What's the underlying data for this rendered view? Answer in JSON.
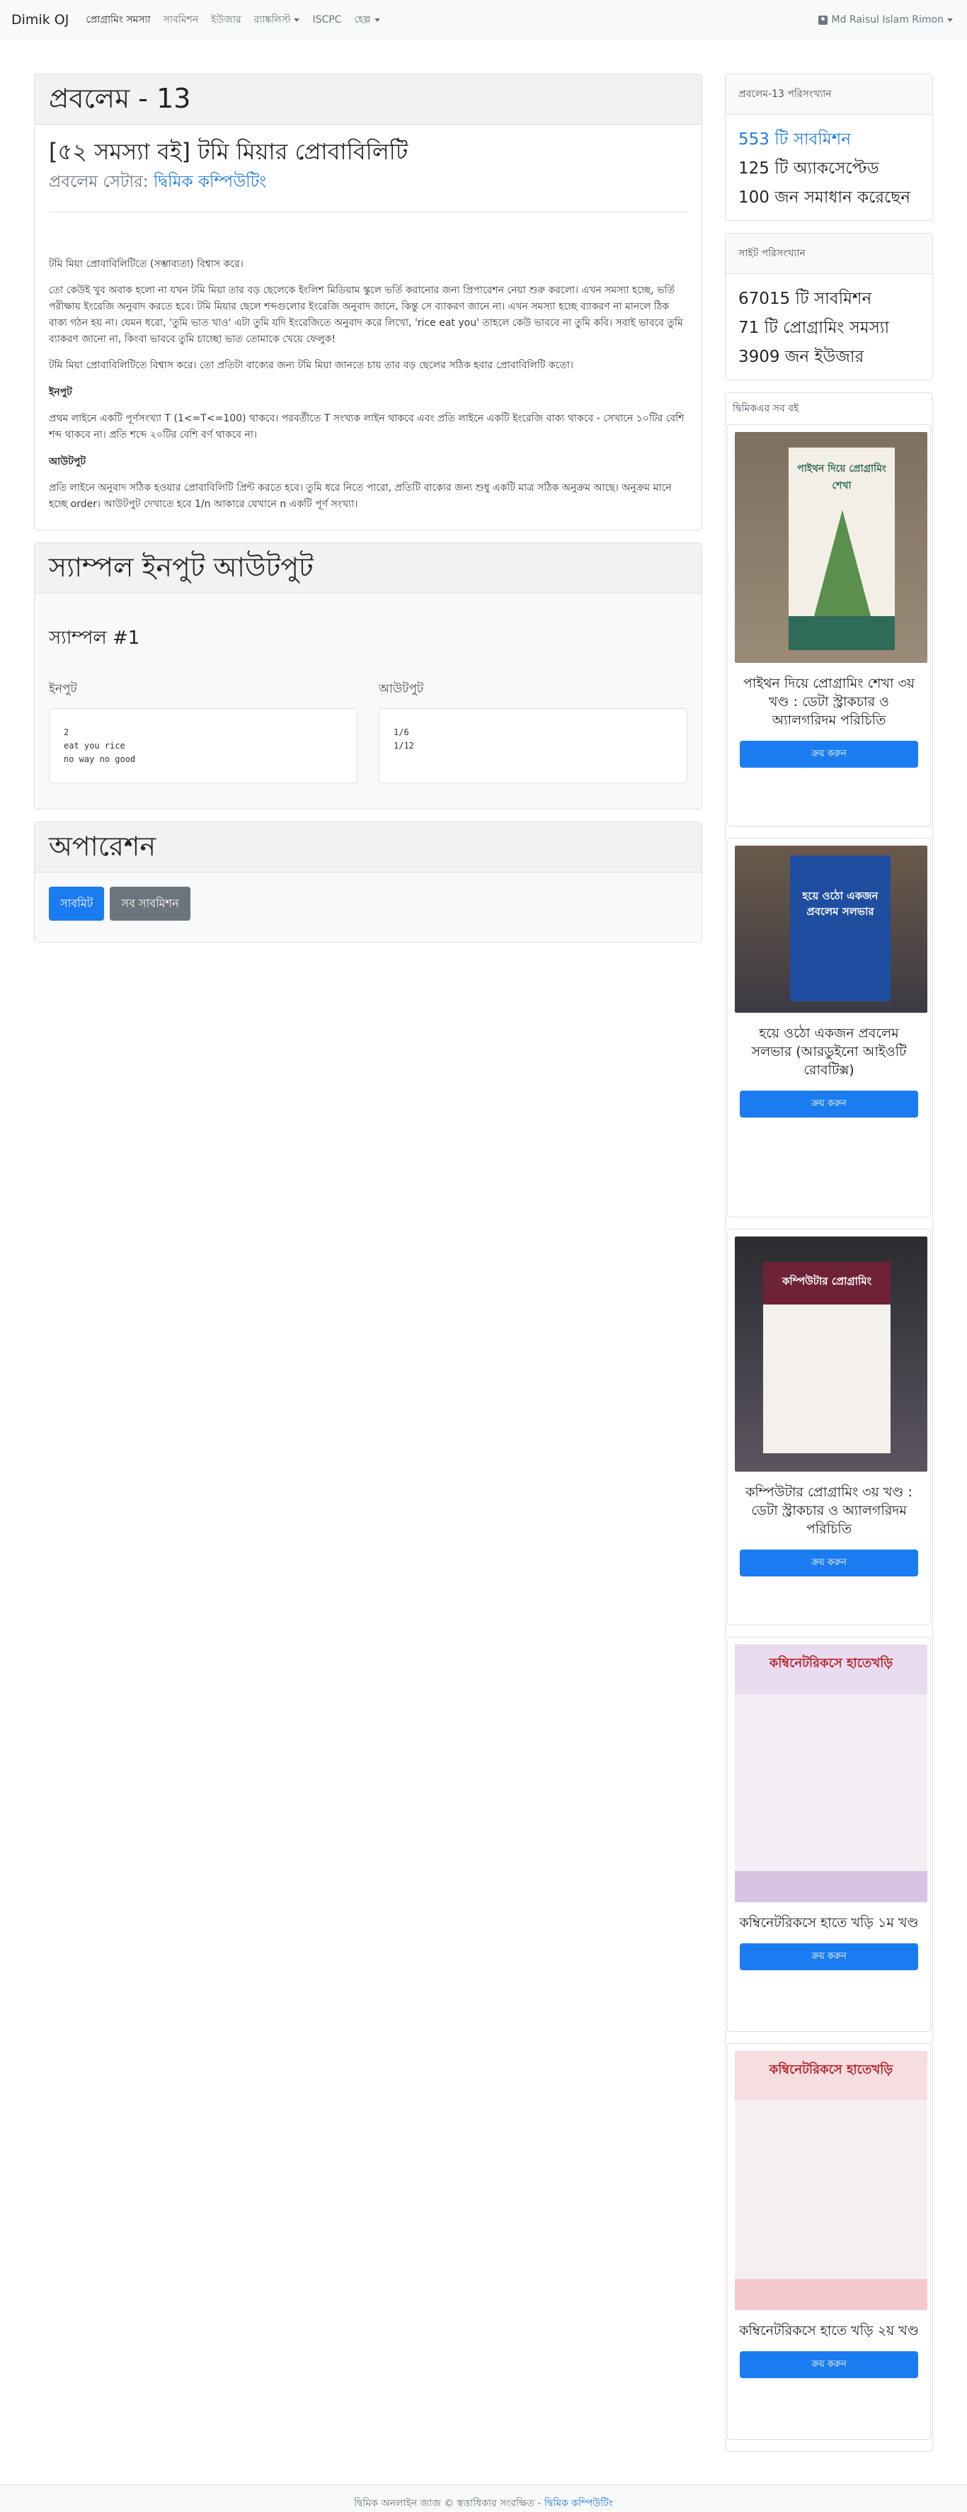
{
  "nav": {
    "brand": "Dimik OJ",
    "items": [
      {
        "label": "প্রোগ্রামিং সমস্যা",
        "active": true
      },
      {
        "label": "সাবমিশন"
      },
      {
        "label": "ইউজার"
      },
      {
        "label": "র‍্যাঙ্কলিস্ট",
        "dropdown": true
      },
      {
        "label": "ISCPC"
      },
      {
        "label": "হেল্প",
        "dropdown": true
      }
    ],
    "user": "Md Raisul Islam Rimon"
  },
  "problem": {
    "header": "প্রবলেম - 13",
    "title": "[৫২ সমস্যা বই] টমি মিয়ার প্রোবাবিলিটি",
    "setter_label": "প্রবলেম সেটার:",
    "setter_name": "দ্বিমিক কম্পিউটিং",
    "statement": [
      "টমি মিয়া প্রোবাবিলিটিতে (সম্ভাব্যতা) বিশ্বাস করে।",
      "তো কেউই খুব অবাক হলো না যখন টমি মিয়া তার বড় ছেলেকে ইংলিশ মিডিয়াম স্কুলে ভর্তি করানোর জন্য প্রিপারেশন নেয়া শুরু করলো। এখন সমস্যা হচ্ছে, ভর্তি পরীক্ষায় ইংরেজি অনুবাদ করতে হবে। টমি মিয়ার ছেলে শব্দগুলোর ইংরেজি অনুবাদ জানে, কিন্তু সে ব্যাকরণ জানে না। এখন সমস্যা হচ্ছে ব্যাকরণ না মানলে ঠিক বাক্য গঠন হয় না। যেমন ধরো, 'তুমি ভাত খাও' এটা তুমি যদি ইংরেজিতে অনুবাদ করে লিখো, 'rice eat you' তাহলে কেউ ভাববে না তুমি কবি। সবাই ভাববে তুমি ব্যাকরণ জানো না, কিংবা ভাববে তুমি চাচ্ছো ভাত তোমাকে খেয়ে ফেলুক!",
      "টমি মিয়া প্রোবাবিলিটিতে বিশ্বাস করে। তো প্রতিটা বাক্যের জন্য টমি মিয়া জানতে চায় তার বড় ছেলের সঠিক হবার প্রোবাবিলিটি কতো।"
    ],
    "input_heading": "ইনপুট",
    "input_text": "প্রথম লাইনে একটি পূর্ণসংখ্যা T (1<=T<=100) থাকবে। পরবর্তীতে T সংখ্যক লাইন থাকবে এবং প্রতি লাইনে একটি ইংরেজি বাক্য থাকবে - সেখানে ১০টির বেশি শব্দ থাকবে না। প্রতি শব্দে ২০টির বেশি বর্ণ থাকবে না।",
    "output_heading": "আউটপুট",
    "output_text": "প্রতি লাইনে অনুবাদ সঠিক হওয়ার প্রোবাবিলিটি প্রিন্ট করতে হবে। তুমি ধরে নিতে পারো, প্রতিটি বাক্যের জন্য শুধু একটি মাত্র সঠিক অনুক্রম আছে। অনুক্রম মানে হচ্ছে order। আউটপুট দেখাতে হবে 1/n আকারে যেখানে n একটি পূর্ণ সংখ্যা।"
  },
  "samples": {
    "header": "স্যাম্পল ইনপুট আউটপুট",
    "title": "স্যাম্পল #1",
    "input_label": "ইনপুট",
    "output_label": "আউটপুট",
    "input": "2\neat you rice\nno way no good",
    "output": "1/6\n1/12"
  },
  "operations": {
    "header": "অপারেশন",
    "submit": "সাবমিট",
    "all_submissions": "সব সাবমিশন"
  },
  "problem_stats": {
    "header": "প্রবলেম-13 পরিসংখ্যান",
    "submissions": "553 টি সাবমিশন",
    "accepted": "125 টি অ্যাকসেপ্টেড",
    "solved_by": "100 জন সমাধান করেছেন"
  },
  "site_stats": {
    "header": "সাইট পরিসংখ্যান",
    "submissions": "67015 টি সাবমিশন",
    "problems": "71 টি প্রোগ্রামিং সমস্যা",
    "users": "3909 জন ইউজার"
  },
  "books": {
    "header": "দ্বিমিকএর সব বই",
    "buy_label": "ক্রয় করুন",
    "items": [
      {
        "title": "পাইথন দিয়ে প্রোগ্রামিং শেখা ৩য় খণ্ড : ডেটা স্ট্রাকচার ও অ্যালগরিদম পরিচিতি",
        "cover_text": "পাইথন দিয়ে প্রোগ্রামিং শেখা",
        "cover_color": "#2f6b57"
      },
      {
        "title": "হয়ে ওঠো একজন প্রবলেম সলভার (আরডুইনো আইওটি রোবটিক্স)",
        "cover_text": "হয়ে ওঠো একজন প্রবলেম সলভার",
        "cover_color": "#1f4ea0"
      },
      {
        "title": "কম্পিউটার প্রোগ্রামিং ৩য় খণ্ড : ডেটা স্ট্রাকচার ও অ্যালগরিদম পরিচিতি",
        "cover_text": "কম্পিউটার প্রোগ্রামিং",
        "cover_color": "#6e2236"
      },
      {
        "title": "কম্বিনেটরিকসে হাতে খড়ি ১ম খণ্ড",
        "cover_text": "কম্বিনেটরিকসে হাতেখড়ি",
        "cover_color": "#e9dcf0"
      },
      {
        "title": "কম্বিনেটরিকসে হাতে খড়ি ২য় খণ্ড",
        "cover_text": "কম্বিনেটরিকসে হাতেখড়ি",
        "cover_color": "#f6dde0"
      }
    ]
  },
  "footer": {
    "text": "দ্বিমিক অনলাইন জাজ © স্বত্তাধিকার সংরক্ষিত -",
    "link": "দ্বিমিক কম্পিউটিং"
  }
}
